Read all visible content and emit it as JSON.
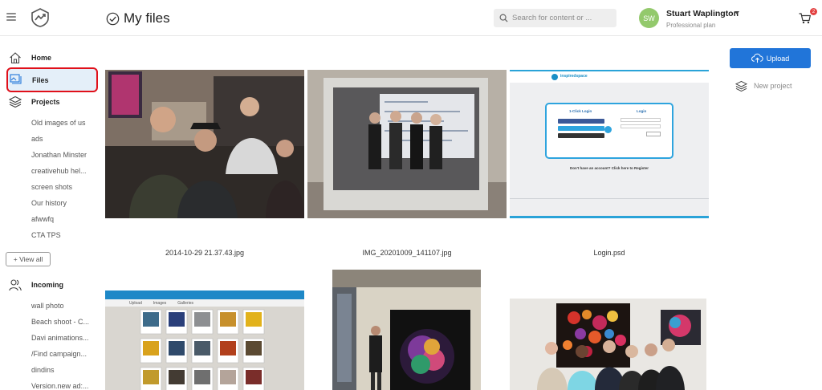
{
  "header": {
    "title": "My files",
    "search_placeholder": "Search for content or ...",
    "user": {
      "initials": "SW",
      "name": "Stuart Waplington",
      "plan": "Professional plan"
    },
    "cart_count": "2"
  },
  "sidebar": {
    "home": "Home",
    "files": "Files",
    "projects": {
      "label": "Projects",
      "items": [
        "Old images of us",
        "ads",
        "Jonathan Minster",
        "creativehub hel...",
        "screen shots",
        "Our history",
        "afwwfq",
        "CTA TPS"
      ]
    },
    "view_all": "+ View all",
    "incoming": {
      "label": "Incoming",
      "items": [
        "wall photo",
        "Beach shoot - C...",
        "Davi animations...",
        "/Find campaign...",
        "dindins",
        "Version.new ad:..."
      ]
    }
  },
  "actions": {
    "upload": "Upload",
    "new_project": "New project"
  },
  "files": [
    {
      "name": "2014-10-29 21.37.43.jpg"
    },
    {
      "name": "IMG_20201009_141107.jpg"
    },
    {
      "name": "Login.psd"
    },
    {
      "name": ""
    },
    {
      "name": ""
    },
    {
      "name": ""
    }
  ],
  "login_mock": {
    "brand": "inspiredspace",
    "left_heading": "1-Click Login",
    "right_heading": "Login",
    "register_text": "Don't have an account? Click here to Register"
  },
  "gallery_mock": {
    "tabs": [
      "Upload",
      "Images",
      "Galleries"
    ]
  },
  "colors": {
    "accent": "#2175d9",
    "highlight_border": "#e0101a",
    "active_bg": "#e4eff9",
    "avatar": "#93c96c"
  }
}
